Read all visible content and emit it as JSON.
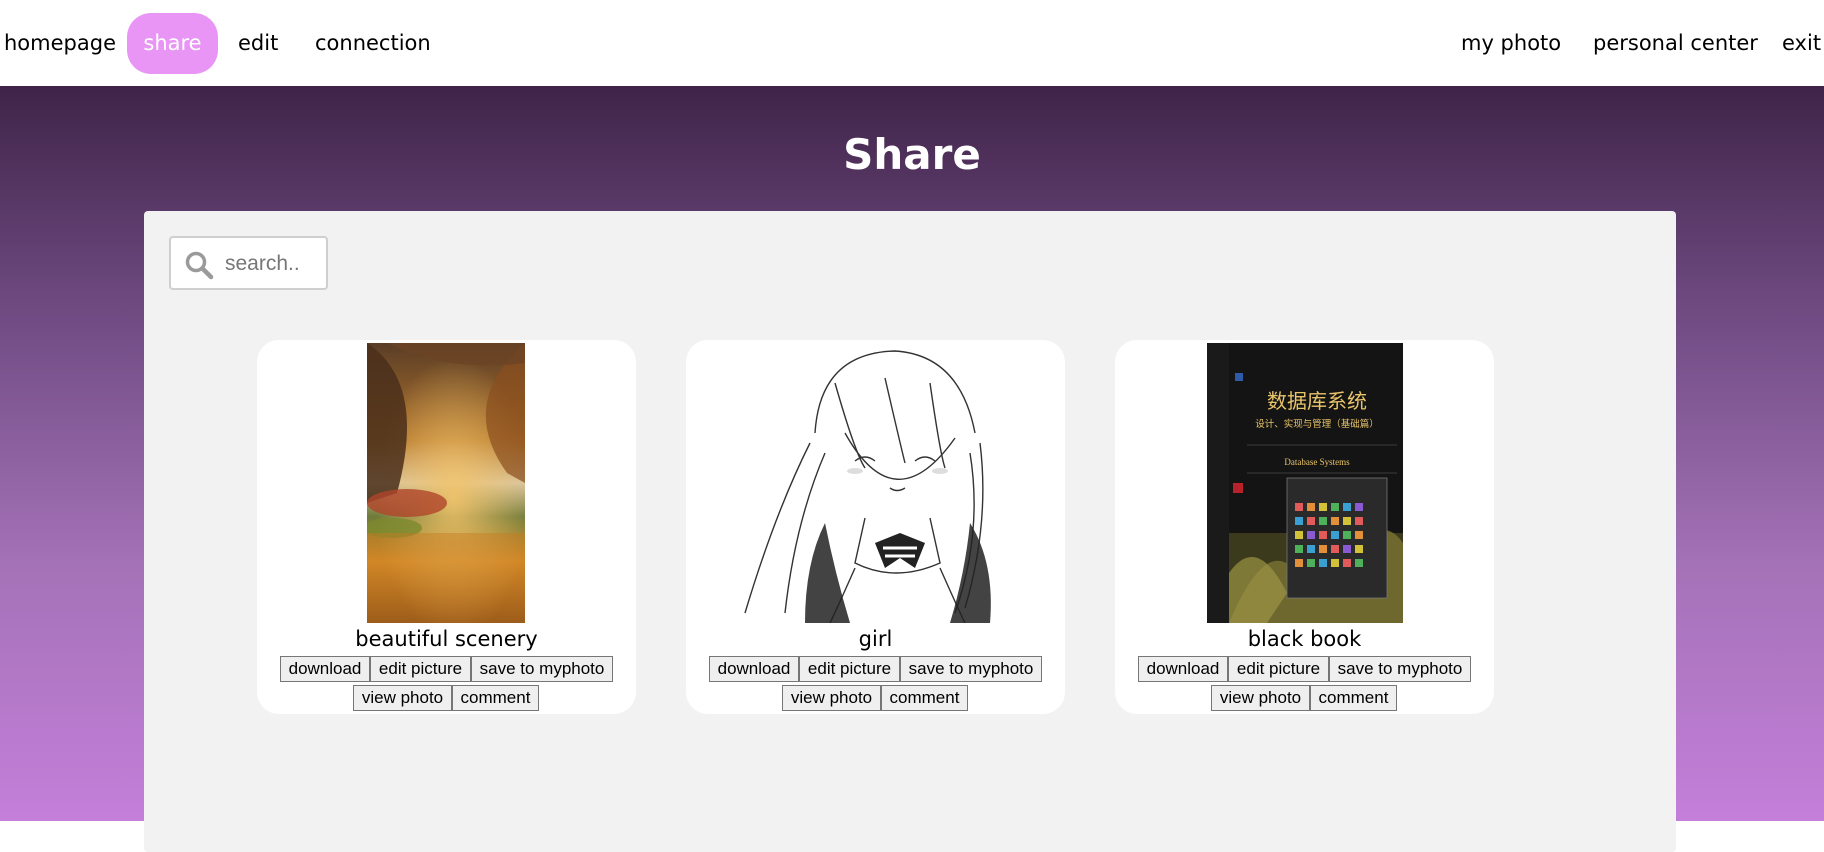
{
  "nav": {
    "left": [
      "homepage",
      "share",
      "edit",
      "connection"
    ],
    "right": [
      "my photo",
      "personal center",
      "exit"
    ],
    "active": "share",
    "active_color": "#e995f6"
  },
  "page": {
    "title": "Share"
  },
  "search": {
    "placeholder": "search.."
  },
  "cards": [
    {
      "title": "beautiful scenery",
      "image": "autumn tree tunnel over lake"
    },
    {
      "title": "girl",
      "image": "manga girl line art"
    },
    {
      "title": "black book",
      "image": "Database Systems book cover"
    }
  ],
  "buttons": {
    "download": "download",
    "edit": "edit picture",
    "save": "save to myphoto",
    "view": "view photo",
    "comment": "comment"
  },
  "book_cover": {
    "title_cn": "数据库系统",
    "subtitle_cn": "设计、实现与管理（基础篇）",
    "title_en": "Database Systems"
  },
  "colors": {
    "gradient_top": "#3f2448",
    "gradient_bottom": "#c47fda",
    "panel": "#f2f2f2"
  }
}
